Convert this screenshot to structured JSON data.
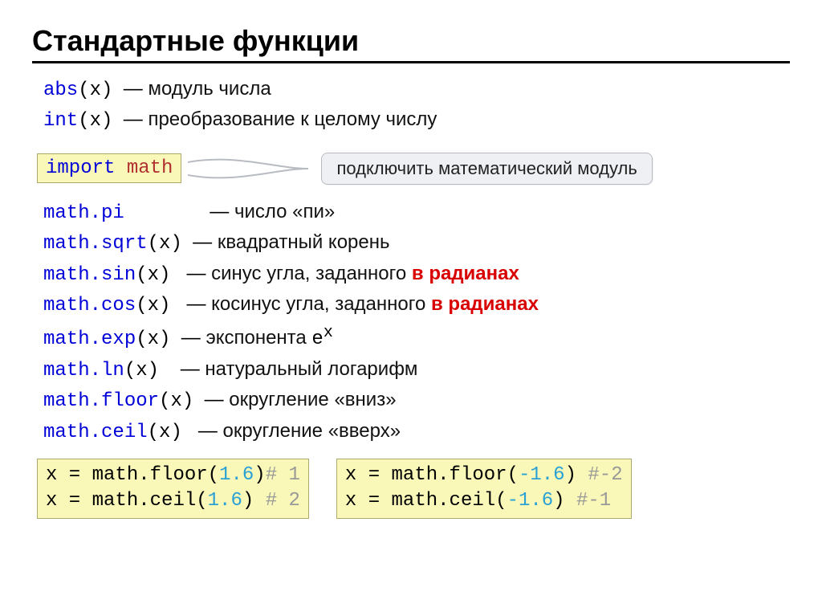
{
  "title": "Стандартные функции",
  "top_fns": [
    {
      "name": "abs",
      "arg": "x",
      "desc": "модуль числа"
    },
    {
      "name": "int",
      "arg": "x",
      "desc": "преобразование к целому числу"
    }
  ],
  "import_stmt": {
    "kw": "import",
    "mod": "math"
  },
  "callout": "подключить математический модуль",
  "math_fns": [
    {
      "call": "math.pi",
      "arg": null,
      "desc_pre": "число «пи»",
      "desc_red": null,
      "sup": null
    },
    {
      "call": "math.sqrt",
      "arg": "x",
      "desc_pre": "квадратный корень",
      "desc_red": null,
      "sup": null
    },
    {
      "call": "math.sin",
      "arg": "x",
      "desc_pre": "синус угла, заданного ",
      "desc_red": "в радианах",
      "sup": null
    },
    {
      "call": "math.cos",
      "arg": "x",
      "desc_pre": "косинус угла, заданного ",
      "desc_red": "в радианах",
      "sup": null
    },
    {
      "call": "math.exp",
      "arg": "x",
      "desc_pre": "экспонента ",
      "desc_red": null,
      "sup": "e^x"
    },
    {
      "call": "math.ln",
      "arg": "x",
      "desc_pre": "натуральный логарифм",
      "desc_red": null,
      "sup": null
    },
    {
      "call": "math.floor",
      "arg": "x",
      "desc_pre": "округление «вниз»",
      "desc_red": null,
      "sup": null
    },
    {
      "call": "math.ceil",
      "arg": "x",
      "desc_pre": "округление «вверх»",
      "desc_red": null,
      "sup": null
    }
  ],
  "examples": [
    [
      {
        "lhs": "x",
        "fn": "math.floor",
        "arg": "1.6",
        "cmt": "# 1"
      },
      {
        "lhs": "x",
        "fn": "math.ceil",
        "arg": "1.6",
        "cmt": "# 2"
      }
    ],
    [
      {
        "lhs": "x",
        "fn": "math.floor",
        "arg": "-1.6",
        "cmt": "#-2"
      },
      {
        "lhs": "x",
        "fn": "math.ceil",
        "arg": "-1.6",
        "cmt": "#-1"
      }
    ]
  ]
}
